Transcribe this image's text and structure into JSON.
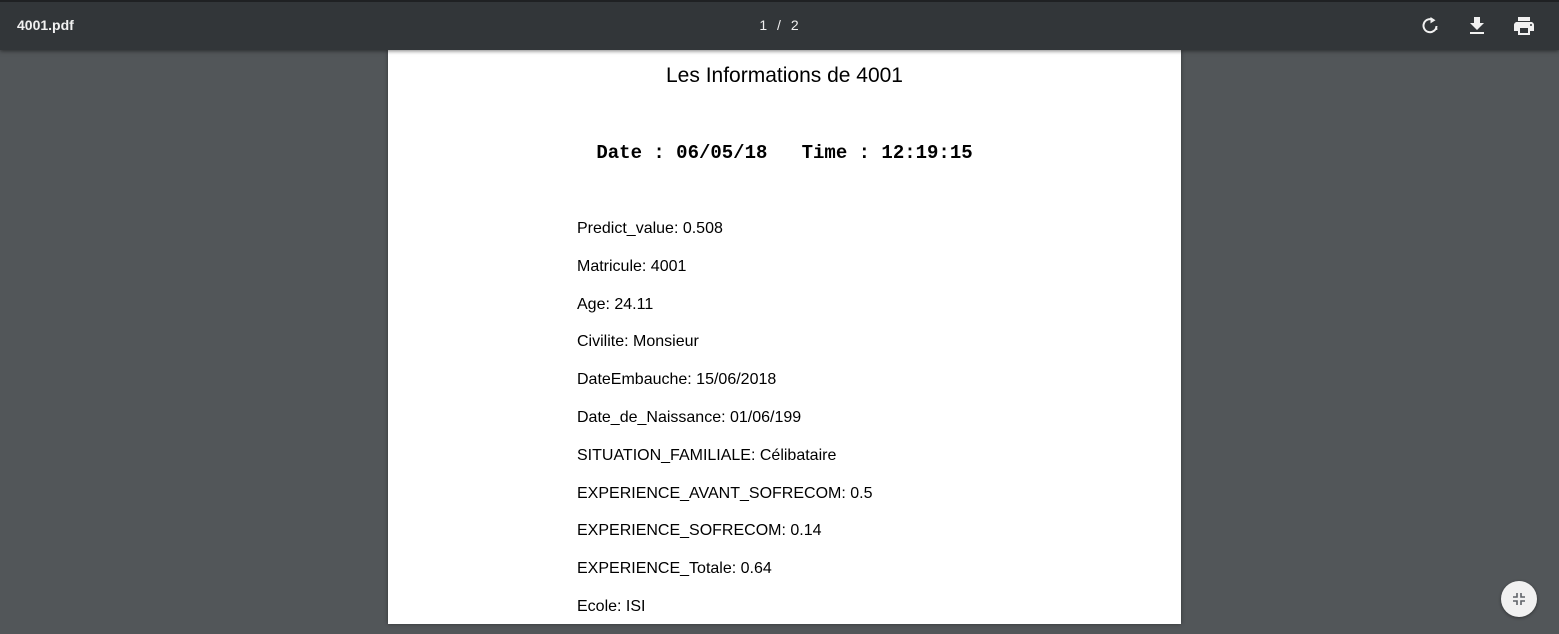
{
  "toolbar": {
    "title": "4001.pdf",
    "page_current": "1",
    "page_separator": "/",
    "page_total": "2",
    "icons": [
      "rotate-icon",
      "download-icon",
      "print-icon"
    ]
  },
  "document": {
    "title": "Les Informations de 4001",
    "date_label": "Date : 06/05/18",
    "time_label": "Time : 12:19:15",
    "fields": [
      "Predict_value: 0.508",
      "Matricule: 4001",
      "Age: 24.11",
      "Civilite: Monsieur",
      "DateEmbauche: 15/06/2018",
      "Date_de_Naissance: 01/06/199",
      "SITUATION_FAMILIALE: Célibataire",
      "EXPERIENCE_AVANT_SOFRECOM: 0.5",
      "EXPERIENCE_SOFRECOM: 0.14",
      "EXPERIENCE_Totale: 0.64",
      "Ecole: ISI"
    ]
  },
  "fab": {
    "icon": "fit-page-icon"
  },
  "colors": {
    "toolbar_bg": "#323639",
    "viewer_bg": "#525659",
    "page_bg": "#ffffff",
    "toolbar_text": "#f1f1f1"
  }
}
